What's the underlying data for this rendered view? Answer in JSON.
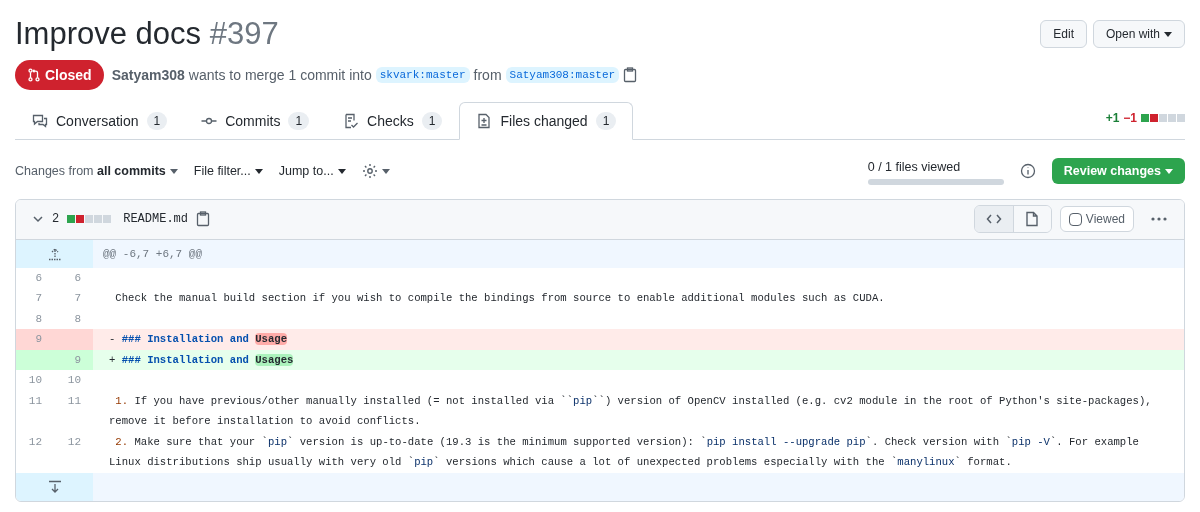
{
  "title": "Improve docs",
  "number": "#397",
  "state": {
    "kind": "closed",
    "label": "Closed"
  },
  "summary": {
    "author": "Satyam308",
    "text": "wants to merge 1 commit into",
    "base": "skvark:master",
    "from": "from",
    "head": "Satyam308:master"
  },
  "header_buttons": [
    {
      "label": "Edit",
      "dropdown": false
    },
    {
      "label": "Open with",
      "dropdown": true
    }
  ],
  "tabs": [
    {
      "label": "Conversation",
      "count": "1",
      "kind": "conversation",
      "selected": false
    },
    {
      "label": "Commits",
      "count": "1",
      "kind": "commit",
      "selected": false
    },
    {
      "label": "Checks",
      "count": "1",
      "kind": "checks",
      "selected": false
    },
    {
      "label": "Files changed",
      "count": "1",
      "kind": "diff",
      "selected": true
    }
  ],
  "diff_summary": {
    "added": "+1",
    "deleted": "−1",
    "blocks": [
      {
        "kind": "added"
      },
      {
        "kind": "deleted"
      },
      {
        "kind": "neutral"
      },
      {
        "kind": "neutral"
      },
      {
        "kind": "neutral"
      }
    ]
  },
  "toolbar": {
    "changes_prefix": "Changes from",
    "changes_value": "all commits",
    "file_filter": "File filter...",
    "jump_to": "Jump to...",
    "files_viewed": "0 / 1 files viewed",
    "progress": {
      "level": 0
    },
    "review": "Review changes"
  },
  "file": {
    "expanded": true,
    "changes": "2",
    "blocks": [
      {
        "kind": "added"
      },
      {
        "kind": "deleted"
      },
      {
        "kind": "neutral"
      },
      {
        "kind": "neutral"
      },
      {
        "kind": "neutral"
      }
    ],
    "name": "README.md",
    "viewed": false,
    "viewed_label": "Viewed",
    "source_view_selected": true,
    "hunk": "@@ -6,7 +6,7 @@",
    "lines": [
      {
        "kind": "context",
        "old": "6",
        "new": "6"
      },
      {
        "kind": "context",
        "old": "7",
        "new": "7",
        "segments": [
          {
            "kind": "plain",
            "text": " Check the manual build section if you wish to compile the bindings from source to enable additional modules such as CUDA."
          }
        ]
      },
      {
        "kind": "context",
        "old": "8",
        "new": "8"
      },
      {
        "kind": "deleted",
        "old": "9",
        "segments": [
          {
            "kind": "plain",
            "text": "- "
          },
          {
            "kind": "heading",
            "text": "### Installation and "
          },
          {
            "kind": "deleted_word",
            "text": "Usage"
          }
        ]
      },
      {
        "kind": "added",
        "new": "9",
        "segments": [
          {
            "kind": "plain",
            "text": "+ "
          },
          {
            "kind": "heading",
            "text": "### Installation and "
          },
          {
            "kind": "added_word",
            "text": "Usages"
          }
        ]
      },
      {
        "kind": "context",
        "old": "10",
        "new": "10"
      },
      {
        "kind": "context",
        "old": "11",
        "new": "11",
        "segments": [
          {
            "kind": "number",
            "text": " 1."
          },
          {
            "kind": "plain",
            "text": " If you have previous/other manually installed (= not installed via ``"
          },
          {
            "kind": "code",
            "text": "pip"
          },
          {
            "kind": "plain",
            "text": "``) version of OpenCV installed (e.g. cv2 module in the root of Python's site-packages), remove it before installation to avoid conflicts."
          }
        ]
      },
      {
        "kind": "context",
        "old": "12",
        "new": "12",
        "segments": [
          {
            "kind": "number",
            "text": " 2."
          },
          {
            "kind": "plain",
            "text": " Make sure that your `"
          },
          {
            "kind": "code",
            "text": "pip"
          },
          {
            "kind": "plain",
            "text": "` version is up-to-date (19.3 is the minimum supported version): `"
          },
          {
            "kind": "code",
            "text": "pip install --upgrade pip"
          },
          {
            "kind": "plain",
            "text": "`. Check version with `"
          },
          {
            "kind": "code",
            "text": "pip -V"
          },
          {
            "kind": "plain",
            "text": "`. For example Linux distributions ship usually with very old `"
          },
          {
            "kind": "code",
            "text": "pip"
          },
          {
            "kind": "plain",
            "text": "` versions which cause a lot of unexpected problems especially with the `"
          },
          {
            "kind": "code",
            "text": "manylinux"
          },
          {
            "kind": "plain",
            "text": "` format."
          }
        ]
      }
    ]
  }
}
